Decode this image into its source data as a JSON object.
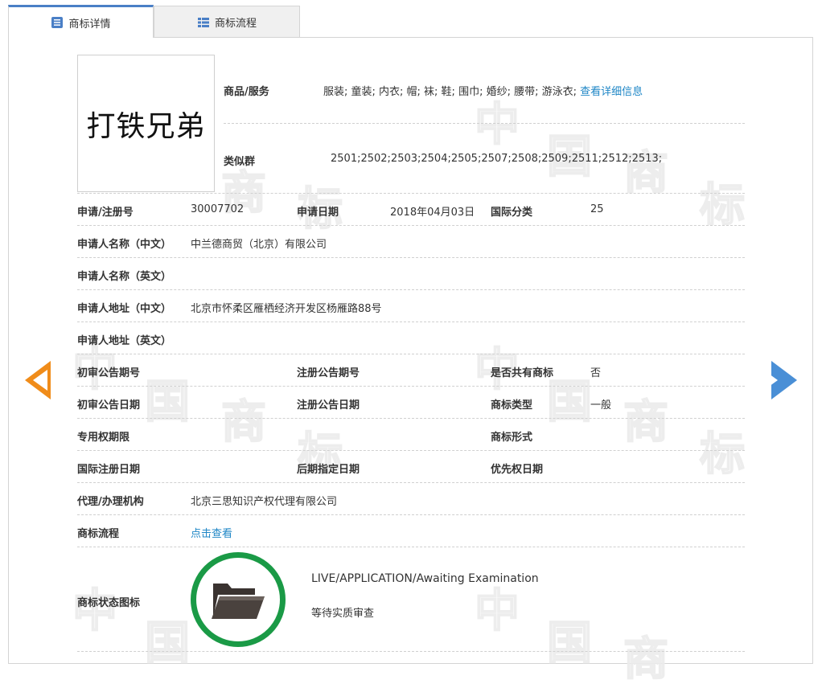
{
  "tabs": [
    {
      "label": "商标详情",
      "active": true
    },
    {
      "label": "商标流程",
      "active": false
    }
  ],
  "logo": {
    "text": "打铁兄弟"
  },
  "goods": {
    "label": "商品/服务",
    "value": "服装; 童装; 内衣; 帽; 袜; 鞋; 围巾; 婚纱; 腰带; 游泳衣;",
    "link": "查看详细信息"
  },
  "similar_group": {
    "label": "类似群",
    "value": "2501;2502;2503;2504;2505;2507;2508;2509;2511;2512;2513;"
  },
  "reg_no": {
    "label": "申请/注册号",
    "value": "30007702"
  },
  "app_date": {
    "label": "申请日期",
    "value": "2018年04月03日"
  },
  "intl_class": {
    "label": "国际分类",
    "value": "25"
  },
  "applicant_cn": {
    "label": "申请人名称（中文）",
    "value": "中兰德商贸（北京）有限公司"
  },
  "applicant_en": {
    "label": "申请人名称（英文）",
    "value": ""
  },
  "address_cn": {
    "label": "申请人地址（中文）",
    "value": "北京市怀柔区雁栖经济开发区杨雁路88号"
  },
  "address_en": {
    "label": "申请人地址（英文）",
    "value": ""
  },
  "prelim_issue": {
    "label": "初审公告期号",
    "value": ""
  },
  "reg_issue": {
    "label": "注册公告期号",
    "value": ""
  },
  "shared": {
    "label": "是否共有商标",
    "value": "否"
  },
  "prelim_date": {
    "label": "初审公告日期",
    "value": ""
  },
  "reg_date": {
    "label": "注册公告日期",
    "value": ""
  },
  "tm_type": {
    "label": "商标类型",
    "value": "一般"
  },
  "exclusive_period": {
    "label": "专用权期限",
    "value": ""
  },
  "tm_form": {
    "label": "商标形式",
    "value": ""
  },
  "intl_reg_date": {
    "label": "国际注册日期",
    "value": ""
  },
  "later_date": {
    "label": "后期指定日期",
    "value": ""
  },
  "priority_date": {
    "label": "优先权日期",
    "value": ""
  },
  "agent": {
    "label": "代理/办理机构",
    "value": "北京三思知识产权代理有限公司"
  },
  "process": {
    "label": "商标流程",
    "link": "点击查看"
  },
  "status": {
    "label": "商标状态图标",
    "en": "LIVE/APPLICATION/Awaiting Examination",
    "cn": "等待实质审查",
    "color": "#1a9a46",
    "icon": "folder-icon"
  },
  "colors": {
    "accent": "#4a7fc6",
    "link": "#1e86c6",
    "prev_arrow": "#f08c1a",
    "next_arrow": "#4a8fd6"
  }
}
